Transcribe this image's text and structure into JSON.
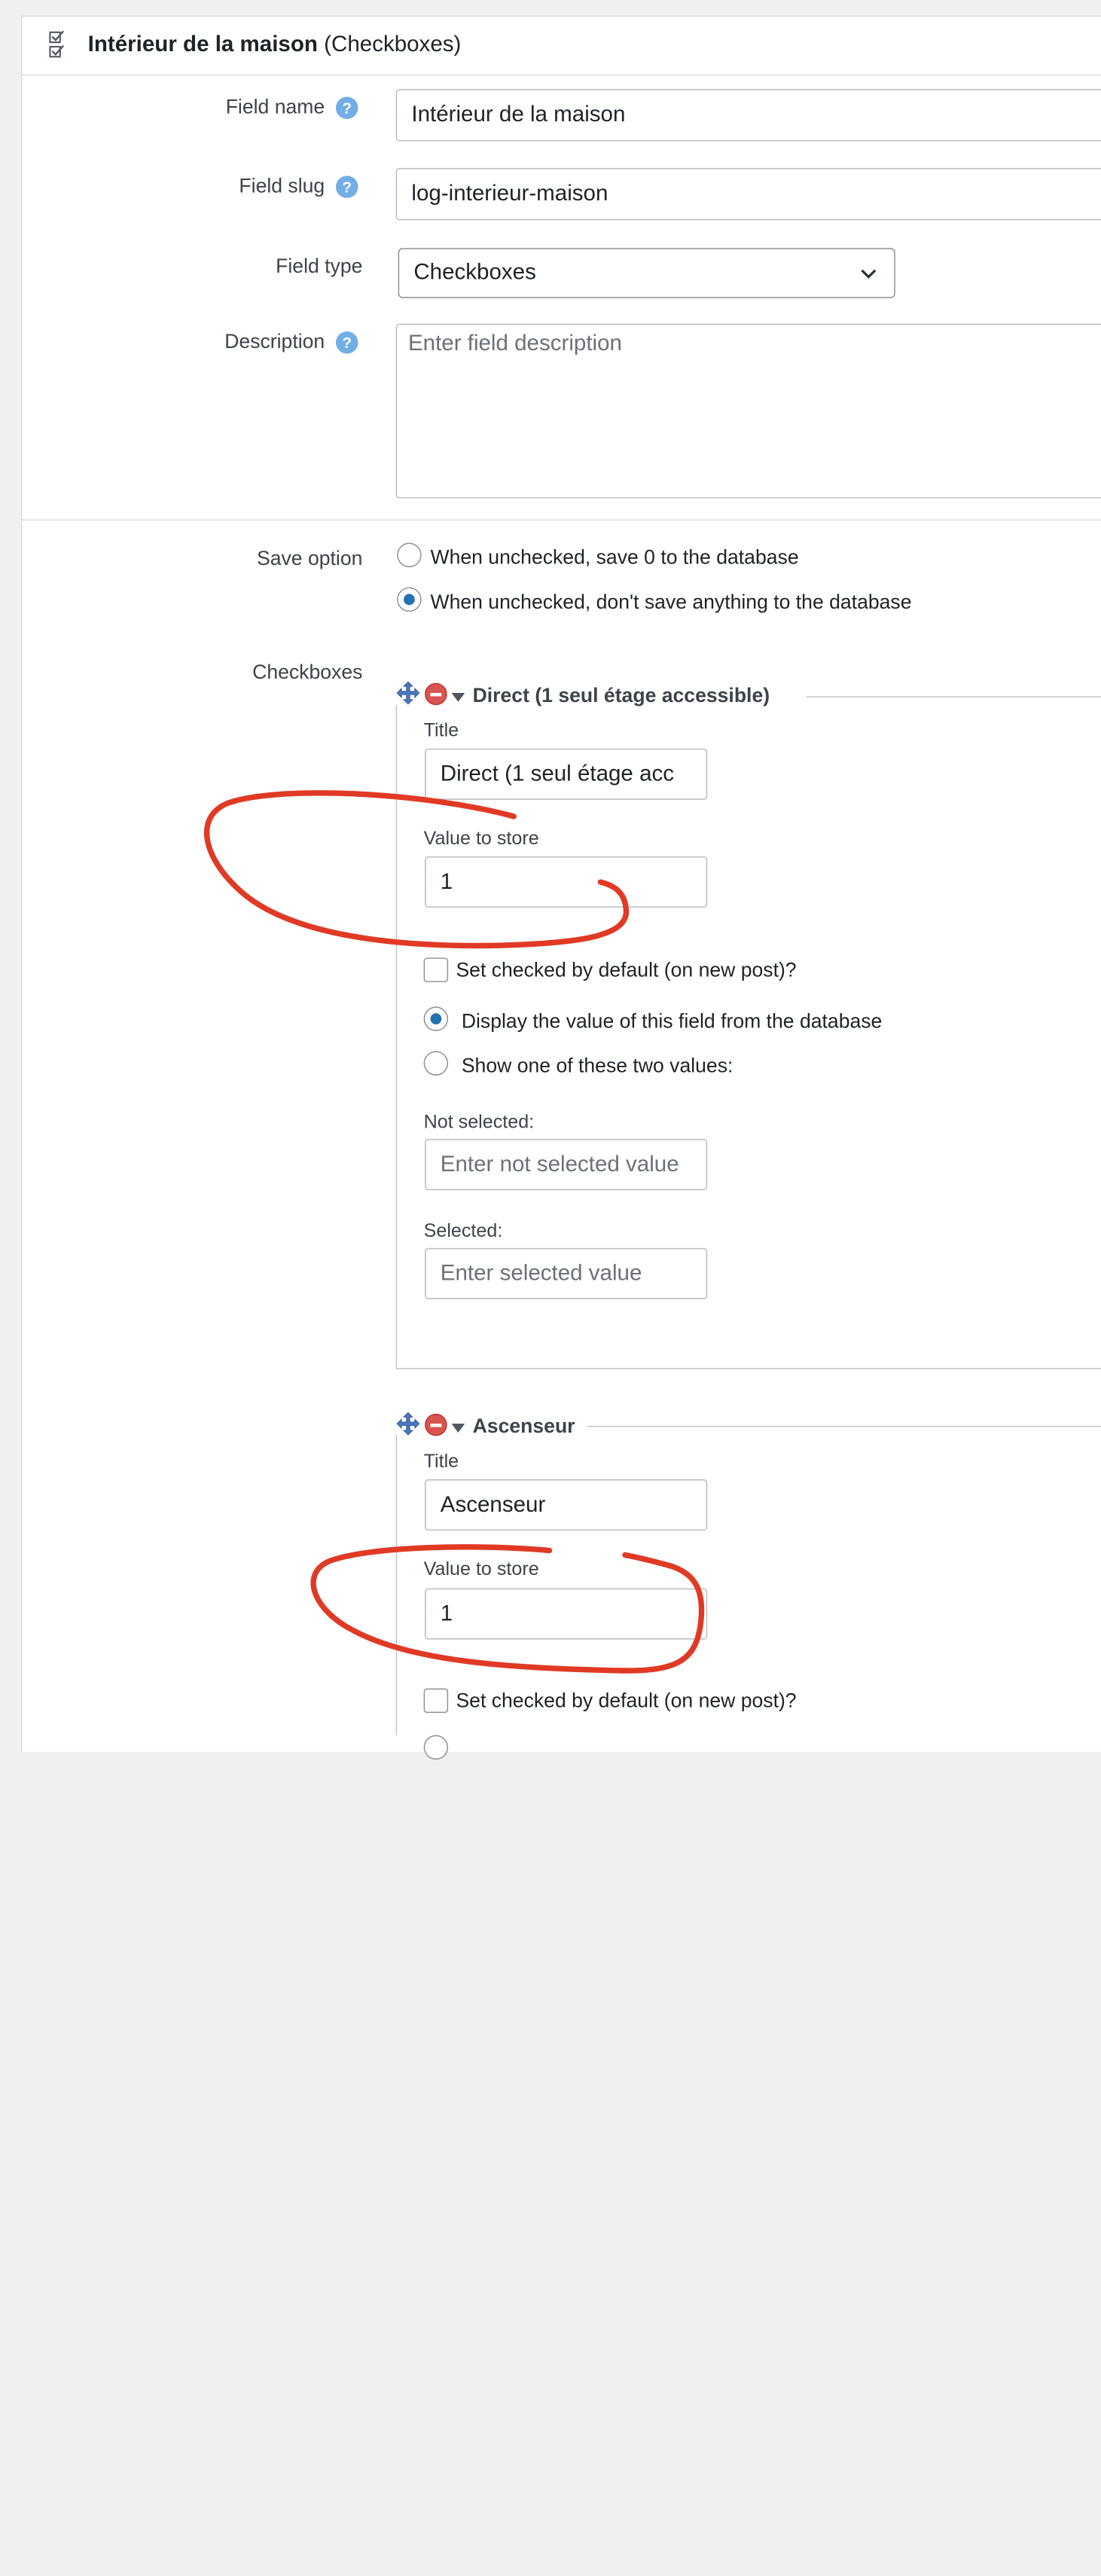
{
  "header": {
    "title": "Intérieur de la maison",
    "type": "(Checkboxes)"
  },
  "fields": {
    "field_name": {
      "label": "Field name",
      "value": "Intérieur de la maison"
    },
    "field_slug": {
      "label": "Field slug",
      "value": "log-interieur-maison"
    },
    "field_type": {
      "label": "Field type",
      "value": "Checkboxes"
    },
    "description": {
      "label": "Description",
      "placeholder": "Enter field description"
    },
    "help_glyph": "?"
  },
  "save_option": {
    "label": "Save option",
    "options": [
      {
        "label": "When unchecked, save 0 to the database",
        "checked": false
      },
      {
        "label": "When unchecked, don't save anything to the database",
        "checked": true
      }
    ]
  },
  "checkboxes": {
    "label": "Checkboxes",
    "items": [
      {
        "legend": "Direct (1 seul étage accessible)",
        "title_label": "Title",
        "title_value": "Direct (1 seul étage acc",
        "value_label": "Value to store",
        "value": "1",
        "default_label": "Set checked by default (on new post)?",
        "display_options": [
          {
            "label": "Display the value of this field from the database",
            "checked": true
          },
          {
            "label": "Show one of these two values:",
            "checked": false
          }
        ],
        "not_selected_label": "Not selected:",
        "not_selected_placeholder": "Enter not selected value",
        "selected_label": "Selected:",
        "selected_placeholder": "Enter selected value"
      },
      {
        "legend": "Ascenseur",
        "title_label": "Title",
        "title_value": "Ascenseur",
        "value_label": "Value to store",
        "value": "1",
        "default_label": "Set checked by default (on new post)?"
      }
    ]
  },
  "colors": {
    "accent": "#2271b1",
    "help": "#72aee6",
    "annotation": "#e03a25",
    "delete": "#d9534f"
  }
}
